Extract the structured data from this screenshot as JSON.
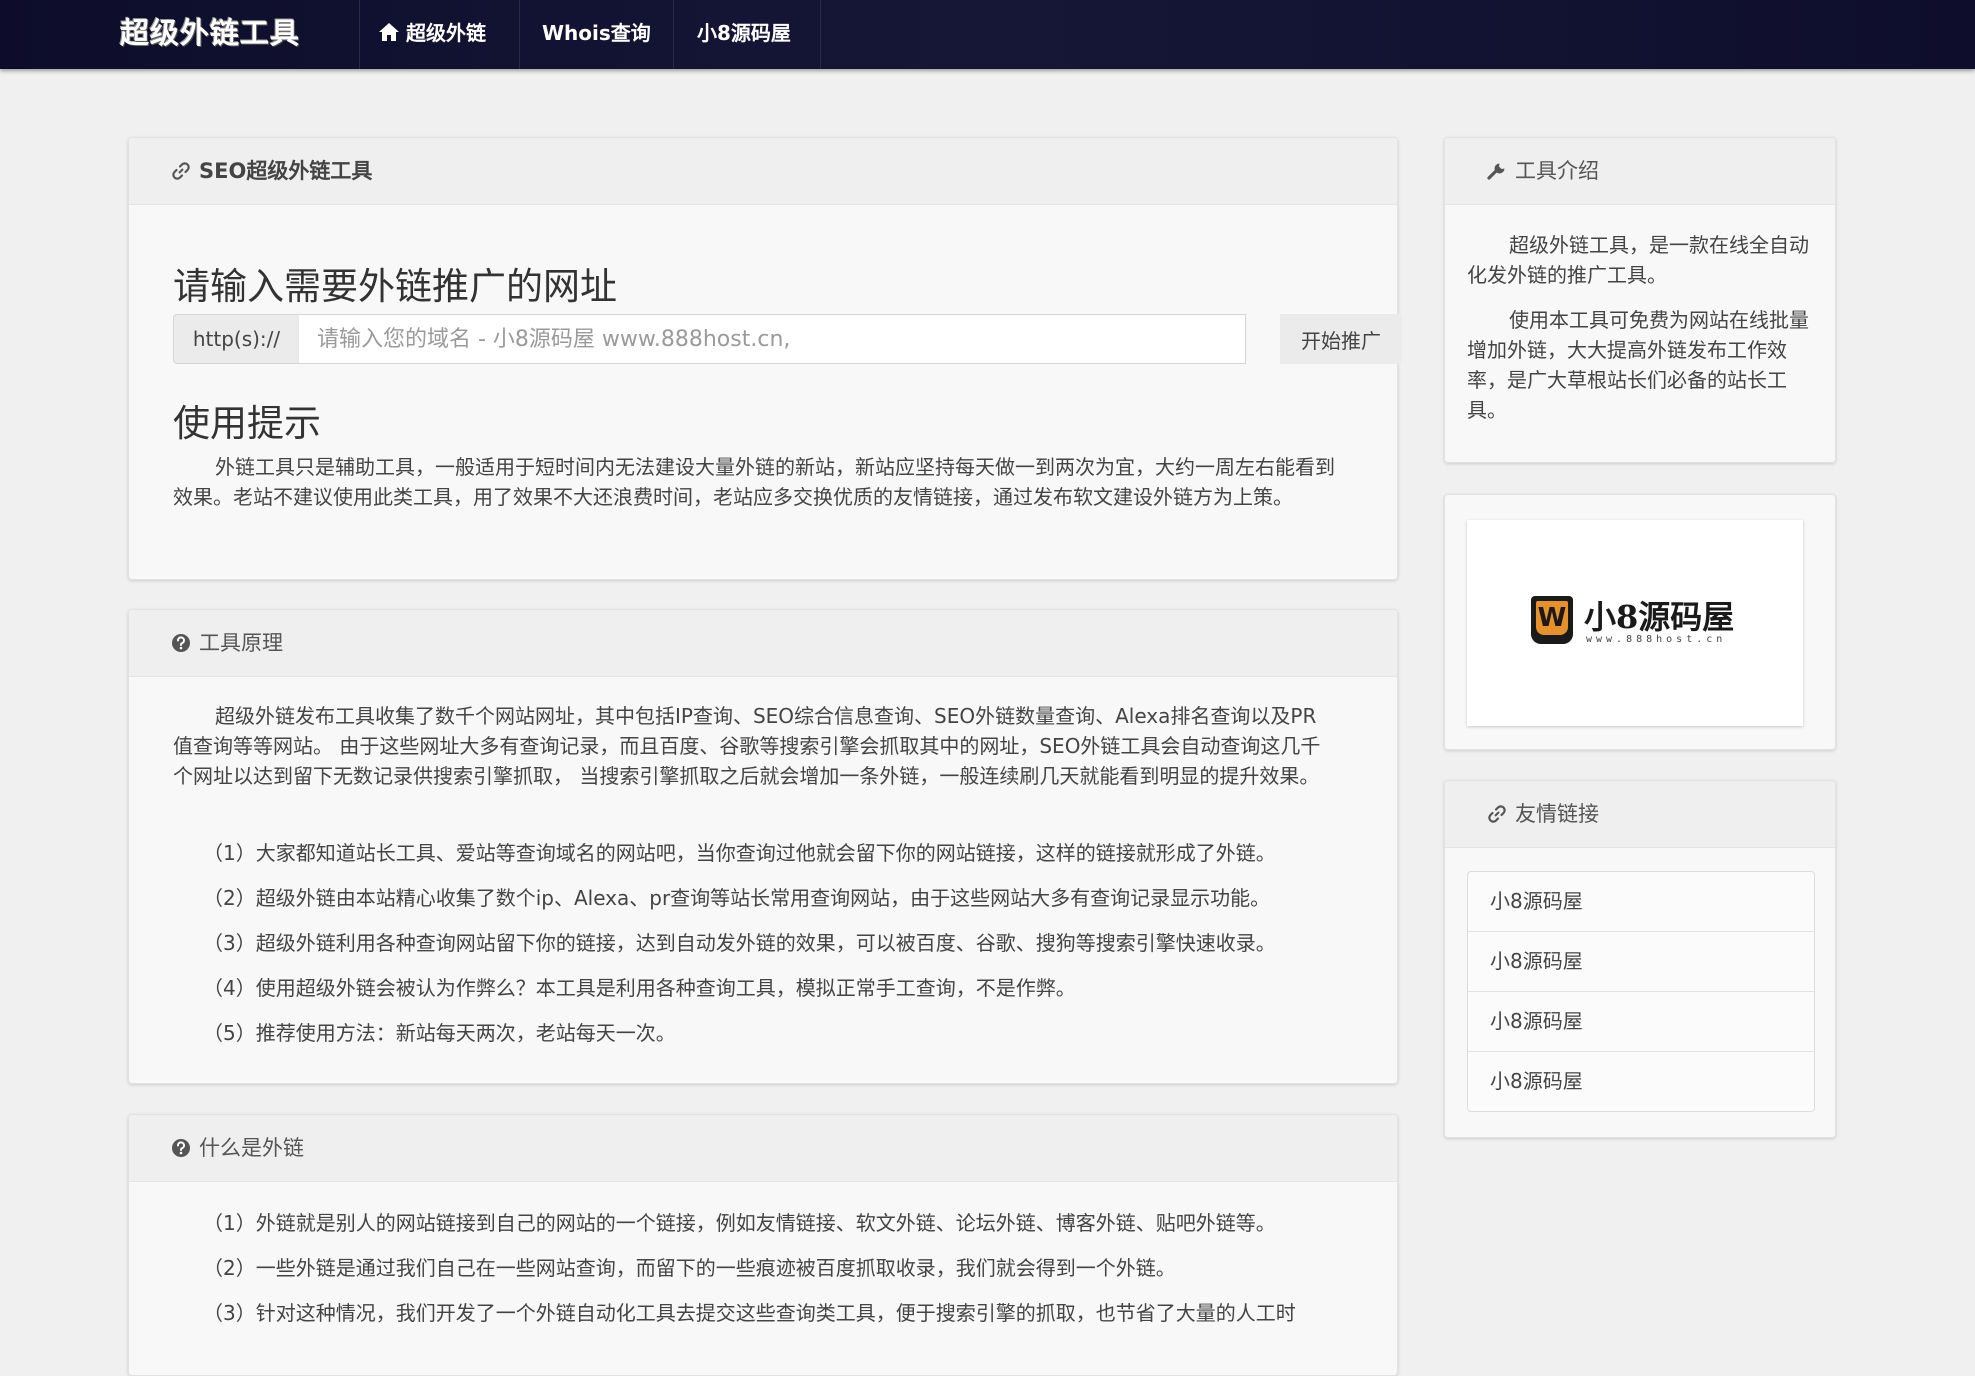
{
  "nav": {
    "brand": "超级外链工具",
    "items": [
      {
        "label": "超级外链",
        "icon": "home-icon"
      },
      {
        "label": "Whois查询"
      },
      {
        "label": "小8源码屋"
      }
    ]
  },
  "main_panel": {
    "title": "SEO超级外链工具",
    "icon": "link-icon",
    "heading": "请输入需要外链推广的网址",
    "prefix": "http(s)://",
    "input_placeholder": "请输入您的域名 - 小8源码屋 www.888host.cn,",
    "input_value": "",
    "submit_label": "开始推广",
    "tips_heading": "使用提示",
    "tips_text": "外链工具只是辅助工具，一般适用于短时间内无法建设大量外链的新站，新站应坚持每天做一到两次为宜，大约一周左右能看到效果。老站不建议使用此类工具，用了效果不大还浪费时间，老站应多交换优质的友情链接，通过发布软文建设外链方为上策。"
  },
  "principle_panel": {
    "title": "工具原理",
    "icon": "question-circle-icon",
    "intro": "超级外链发布工具收集了数千个网站网址，其中包括IP查询、SEO综合信息查询、SEO外链数量查询、Alexa排名查询以及PR值查询等等网站。 由于这些网址大多有查询记录，而且百度、谷歌等搜索引擎会抓取其中的网址，SEO外链工具会自动查询这几千个网址以达到留下无数记录供搜索引擎抓取， 当搜索引擎抓取之后就会增加一条外链，一般连续刷几天就能看到明显的提升效果。",
    "items": [
      "（1）大家都知道站长工具、爱站等查询域名的网站吧，当你查询过他就会留下你的网站链接，这样的链接就形成了外链。",
      "（2）超级外链由本站精心收集了数个ip、Alexa、pr查询等站长常用查询网站，由于这些网站大多有查询记录显示功能。",
      "（3）超级外链利用各种查询网站留下你的链接，达到自动发外链的效果，可以被百度、谷歌、搜狗等搜索引擎快速收录。",
      "（4）使用超级外链会被认为作弊么？本工具是利用各种查询工具，模拟正常手工查询，不是作弊。",
      "（5）推荐使用方法：新站每天两次，老站每天一次。"
    ]
  },
  "what_panel": {
    "title": "什么是外链",
    "icon": "question-circle-icon",
    "items": [
      "（1）外链就是别人的网站链接到自己的网站的一个链接，例如友情链接、软文外链、论坛外链、博客外链、贴吧外链等。",
      "（2）一些外链是通过我们自己在一些网站查询，而留下的一些痕迹被百度抓取收录，我们就会得到一个外链。",
      "（3）针对这种情况，我们开发了一个外链自动化工具去提交这些查询类工具，便于搜索引擎的抓取，也节省了大量的人工时"
    ]
  },
  "intro_panel": {
    "title": "工具介绍",
    "icon": "wrench-icon",
    "para1": "超级外链工具，是一款在线全自动化发外链的推广工具。",
    "para2": "使用本工具可免费为网站在线批量增加外链，大大提高外链发布工作效率，是广大草根站长们必备的站长工具。"
  },
  "logo_panel": {
    "logo_text": "小8源码屋",
    "logo_sub": "www.888host.cn",
    "logo_mark": "W",
    "brand_color": "#e8912a"
  },
  "friends_panel": {
    "title": "友情链接",
    "icon": "link-icon",
    "links": [
      "小8源码屋",
      "小8源码屋",
      "小8源码屋",
      "小8源码屋"
    ]
  }
}
